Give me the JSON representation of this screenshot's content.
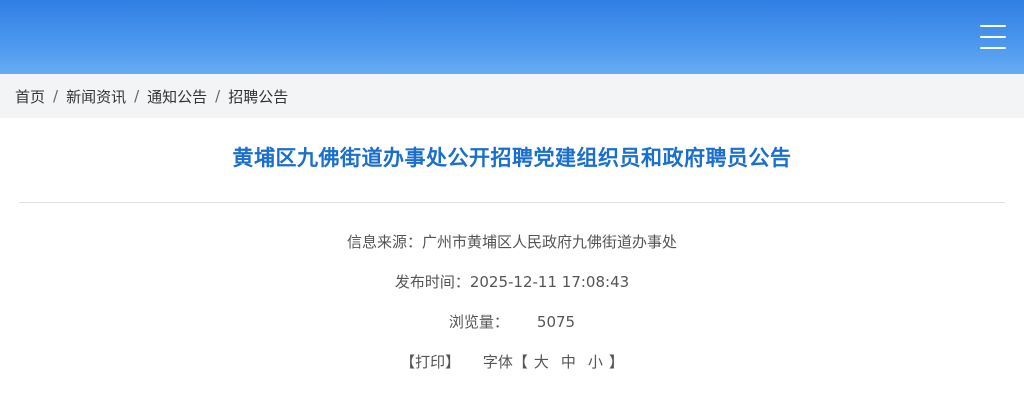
{
  "header": {
    "menu_icon": "hamburger-menu-icon",
    "gradient_top": "#2f7fe4",
    "gradient_bottom": "#67acf3"
  },
  "breadcrumb": {
    "items": [
      "首页",
      "新闻资讯",
      "通知公告",
      "招聘公告"
    ],
    "separator": "/"
  },
  "article": {
    "title": "黄埔区九佛街道办事处公开招聘党建组织员和政府聘员公告",
    "title_color": "#1a6fce",
    "source_label": "信息来源：",
    "source_value": "广州市黄埔区人民政府九佛街道办事处",
    "time_label": "发布时间：",
    "time_value": "2025-12-11 17:08:43",
    "views_label": "浏览量：",
    "views_value": "5075"
  },
  "tools": {
    "print_label": "【打印】",
    "font_label": "字体【",
    "font_large": "大",
    "font_medium": "中",
    "font_small": "小",
    "font_close": "】"
  }
}
